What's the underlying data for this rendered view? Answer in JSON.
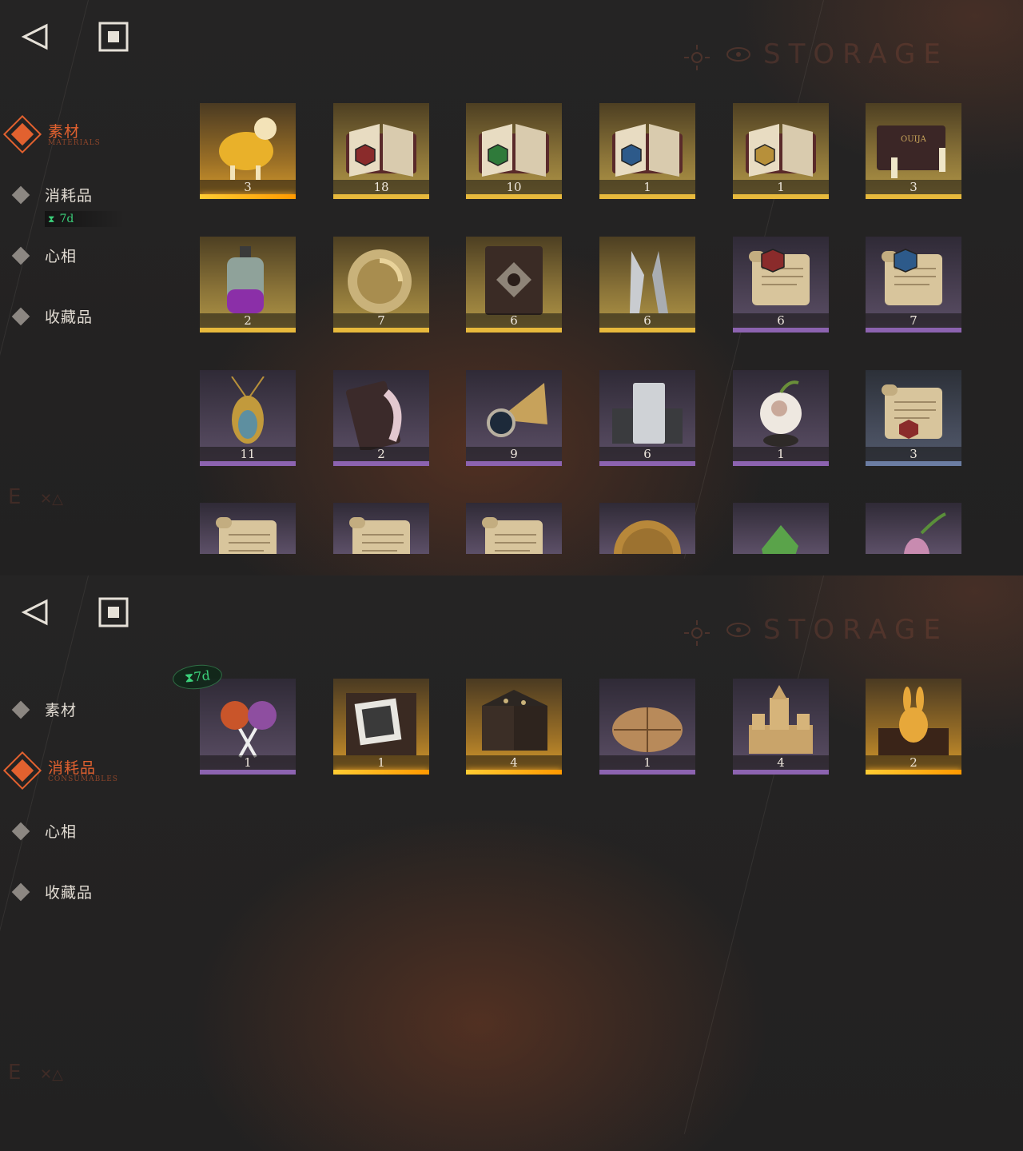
{
  "header": {
    "watermark": "STORAGE"
  },
  "sidebar": {
    "timer": "7d",
    "items": [
      {
        "label": "素材",
        "sub": "MATERIALS"
      },
      {
        "label": "消耗品",
        "sub": "CONSUMABLES"
      },
      {
        "label": "心相",
        "sub": ""
      },
      {
        "label": "收藏品",
        "sub": ""
      }
    ]
  },
  "materials_panel": {
    "active_item": "素材",
    "rows": [
      [
        {
          "icon": "golden-sheep-icon",
          "count": "3",
          "rarity": "orange"
        },
        {
          "icon": "book-red-seal-icon",
          "count": "18",
          "rarity": "gold"
        },
        {
          "icon": "book-green-seal-icon",
          "count": "10",
          "rarity": "gold"
        },
        {
          "icon": "book-blue-seal-icon",
          "count": "1",
          "rarity": "gold"
        },
        {
          "icon": "book-gold-seal-icon",
          "count": "1",
          "rarity": "gold"
        },
        {
          "icon": "ouija-board-icon",
          "count": "3",
          "rarity": "gold"
        }
      ],
      [
        {
          "icon": "potion-bottle-icon",
          "count": "2",
          "rarity": "gold"
        },
        {
          "icon": "gold-pocket-watch-icon",
          "count": "7",
          "rarity": "gold"
        },
        {
          "icon": "leather-tome-icon",
          "count": "6",
          "rarity": "gold"
        },
        {
          "icon": "silver-bullets-icon",
          "count": "6",
          "rarity": "gold"
        },
        {
          "icon": "scroll-red-seal-icon",
          "count": "6",
          "rarity": "purple"
        },
        {
          "icon": "scroll-blue-seal-icon",
          "count": "7",
          "rarity": "purple"
        }
      ],
      [
        {
          "icon": "beetle-amulet-icon",
          "count": "11",
          "rarity": "purple"
        },
        {
          "icon": "feather-case-icon",
          "count": "2",
          "rarity": "purple"
        },
        {
          "icon": "brass-lens-icon",
          "count": "9",
          "rarity": "purple"
        },
        {
          "icon": "silver-ingot-icon",
          "count": "6",
          "rarity": "purple"
        },
        {
          "icon": "cotton-plant-icon",
          "count": "1",
          "rarity": "purple"
        },
        {
          "icon": "scroll-letter-icon",
          "count": "3",
          "rarity": "blue"
        }
      ],
      [
        {
          "icon": "scroll-icon",
          "count": "",
          "rarity": ""
        },
        {
          "icon": "scroll-icon",
          "count": "",
          "rarity": ""
        },
        {
          "icon": "scroll-icon",
          "count": "",
          "rarity": ""
        },
        {
          "icon": "gold-coin-icon",
          "count": "",
          "rarity": ""
        },
        {
          "icon": "green-crystal-icon",
          "count": "",
          "rarity": ""
        },
        {
          "icon": "pink-flower-icon",
          "count": "",
          "rarity": ""
        }
      ]
    ]
  },
  "consumables_panel": {
    "active_item": "消耗品",
    "timer": "7d",
    "items": [
      {
        "icon": "lollipops-icon",
        "count": "1",
        "rarity": "purple"
      },
      {
        "icon": "photo-box-icon",
        "count": "1",
        "rarity": "orange"
      },
      {
        "icon": "rune-stool-icon",
        "count": "4",
        "rarity": "orange"
      },
      {
        "icon": "paper-parcel-icon",
        "count": "1",
        "rarity": "purple"
      },
      {
        "icon": "sand-castle-icon",
        "count": "4",
        "rarity": "purple"
      },
      {
        "icon": "golden-rabbit-box-icon",
        "count": "2",
        "rarity": "orange"
      }
    ]
  },
  "colors": {
    "accent": "#e2612f",
    "timer": "#3bd07a",
    "rarity_gold": "#e7b93c",
    "rarity_purple": "#8c63b0",
    "rarity_blue": "#6b7da3"
  }
}
